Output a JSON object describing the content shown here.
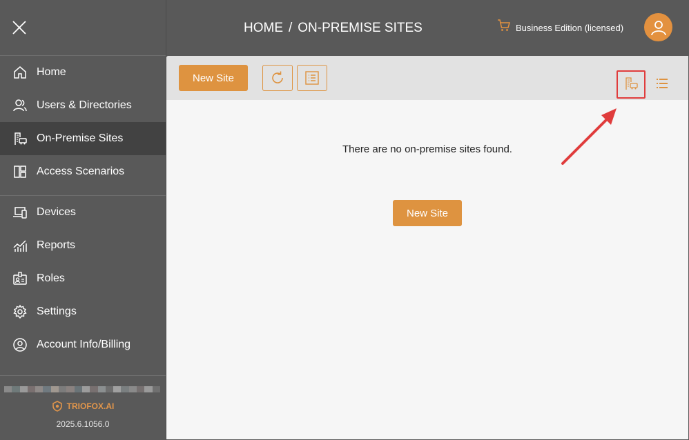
{
  "sidebar": {
    "close_icon": "close-icon",
    "items": [
      {
        "label": "Home",
        "icon": "home-icon"
      },
      {
        "label": "Users & Directories",
        "icon": "users-icon"
      },
      {
        "label": "On-Premise Sites",
        "icon": "building-icon",
        "active": true
      },
      {
        "label": "Access Scenarios",
        "icon": "layout-icon"
      },
      {
        "label": "Devices",
        "icon": "devices-icon"
      },
      {
        "label": "Reports",
        "icon": "chart-icon"
      },
      {
        "label": "Roles",
        "icon": "id-badge-icon"
      },
      {
        "label": "Settings",
        "icon": "gear-icon"
      },
      {
        "label": "Account Info/Billing",
        "icon": "account-icon"
      }
    ],
    "brand": "TRIOFOX.AI",
    "version": "2025.6.1056.0"
  },
  "header": {
    "breadcrumb_home": "HOME",
    "breadcrumb_separator": "/",
    "breadcrumb_current": "ON-PREMISE SITES",
    "edition": "Business Edition (licensed)",
    "cart_icon": "cart-icon",
    "avatar_icon": "user-icon"
  },
  "toolbar": {
    "new_site_label": "New Site",
    "refresh_icon": "refresh-icon",
    "list_detail_icon": "list-detail-icon",
    "site_view_icon": "building-view-icon",
    "list_view_icon": "list-view-icon"
  },
  "main": {
    "empty_message": "There are no on-premise sites found.",
    "new_site_label": "New Site"
  },
  "colors": {
    "accent": "#de9340",
    "sidebar_bg": "#595959",
    "sidebar_active": "#424242",
    "panel_bg": "#f6f6f6",
    "toolbar_bg": "#e2e2e2",
    "annotation": "#e03c3c"
  }
}
